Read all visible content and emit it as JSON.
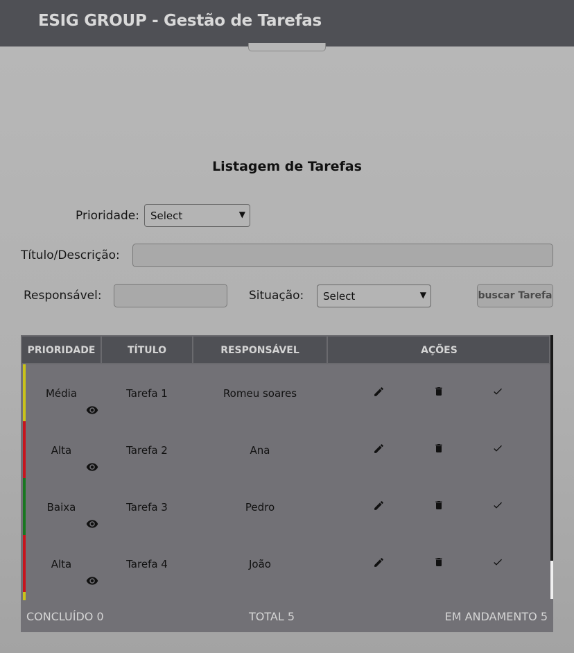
{
  "header": {
    "title": "ESIG GROUP - Gestão de Tarefas"
  },
  "page": {
    "section_title": "Listagem de Tarefas"
  },
  "filters": {
    "priority_label": "Prioridade:",
    "priority_value": "Select",
    "title_label": "Título/Descrição:",
    "title_value": "",
    "responsible_label": "Responsável:",
    "responsible_value": "",
    "status_label": "Situação:",
    "status_value": "Select",
    "search_button": "buscar Tarefa"
  },
  "table": {
    "headers": [
      "PRIORIDADE",
      "TÍTULO",
      "RESPONSÁVEL",
      "AÇÕES"
    ],
    "rows": [
      {
        "priority": "Média",
        "title": "Tarefa 1",
        "responsible": "Romeu soares",
        "color": "#c9c31a"
      },
      {
        "priority": "Alta",
        "title": "Tarefa 2",
        "responsible": "Ana",
        "color": "#c8141d"
      },
      {
        "priority": "Baixa",
        "title": "Tarefa 3",
        "responsible": "Pedro",
        "color": "#17771f"
      },
      {
        "priority": "Alta",
        "title": "Tarefa 4",
        "responsible": "João",
        "color": "#c8141d"
      }
    ],
    "partial_row_color": "#c9c31a",
    "icons": {
      "view": "eye-icon",
      "edit": "pencil-icon",
      "delete": "trash-icon",
      "complete": "check-icon"
    }
  },
  "summary": {
    "done": "CONCLUÍDO 0",
    "total": "TOTAL 5",
    "in_progress": "EM ANDAMENTO 5"
  },
  "colors": {
    "header_bg": "#4f5055",
    "table_bg": "#727176"
  }
}
